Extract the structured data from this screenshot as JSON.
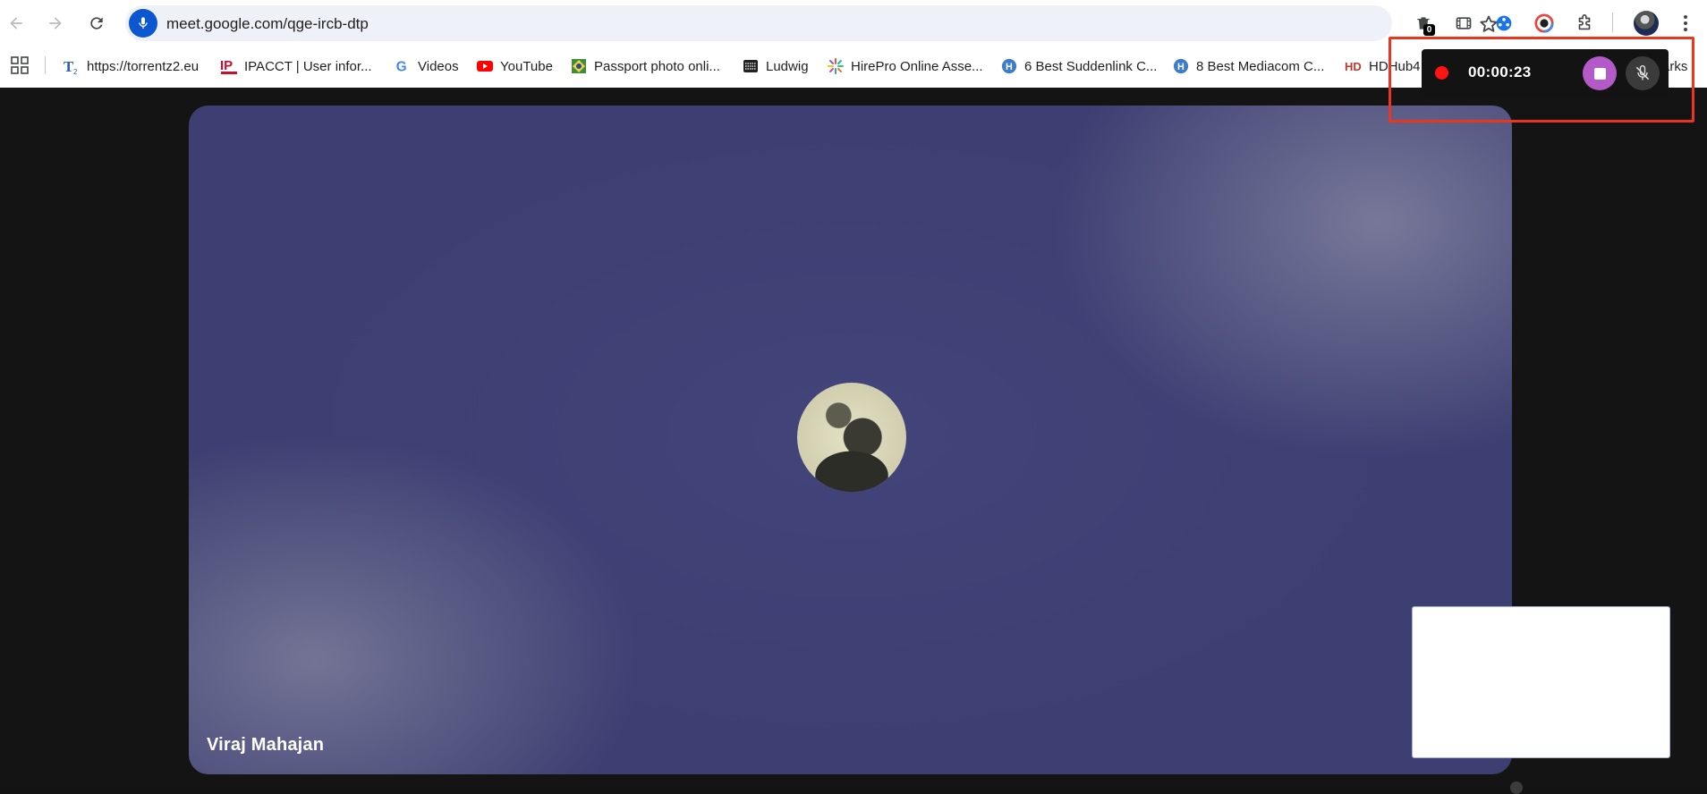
{
  "toolbar": {
    "url": "meet.google.com/qge-ircb-dtp",
    "extension_badge": "0"
  },
  "bookmarks": [
    {
      "label": "https://torrentz2.eu",
      "favicon": "torrentz-icon"
    },
    {
      "label": "IPACCT | User infor...",
      "favicon": "ipacct-icon"
    },
    {
      "label": "Videos",
      "favicon": "google-icon"
    },
    {
      "label": "YouTube",
      "favicon": "youtube-icon"
    },
    {
      "label": "Passport photo onli...",
      "favicon": "passport-icon"
    },
    {
      "label": "Ludwig",
      "favicon": "typewriter-icon"
    },
    {
      "label": "HirePro Online Asse...",
      "favicon": "hirepro-icon"
    },
    {
      "label": "6 Best Suddenlink C...",
      "favicon": "h-circle-icon"
    },
    {
      "label": "8 Best Mediacom C...",
      "favicon": "h-circle-icon"
    },
    {
      "label": "HDHub4",
      "favicon": "hd-icon"
    }
  ],
  "bookmarks_overflow": "arks",
  "meeting": {
    "participant_name": "Viraj Mahajan"
  },
  "recorder": {
    "elapsed": "00:00:23"
  },
  "colors": {
    "accent_blue": "#0b57d0",
    "record_red": "#ff1414",
    "stop_purple": "#b35ac8",
    "highlight": "#e8361f"
  }
}
